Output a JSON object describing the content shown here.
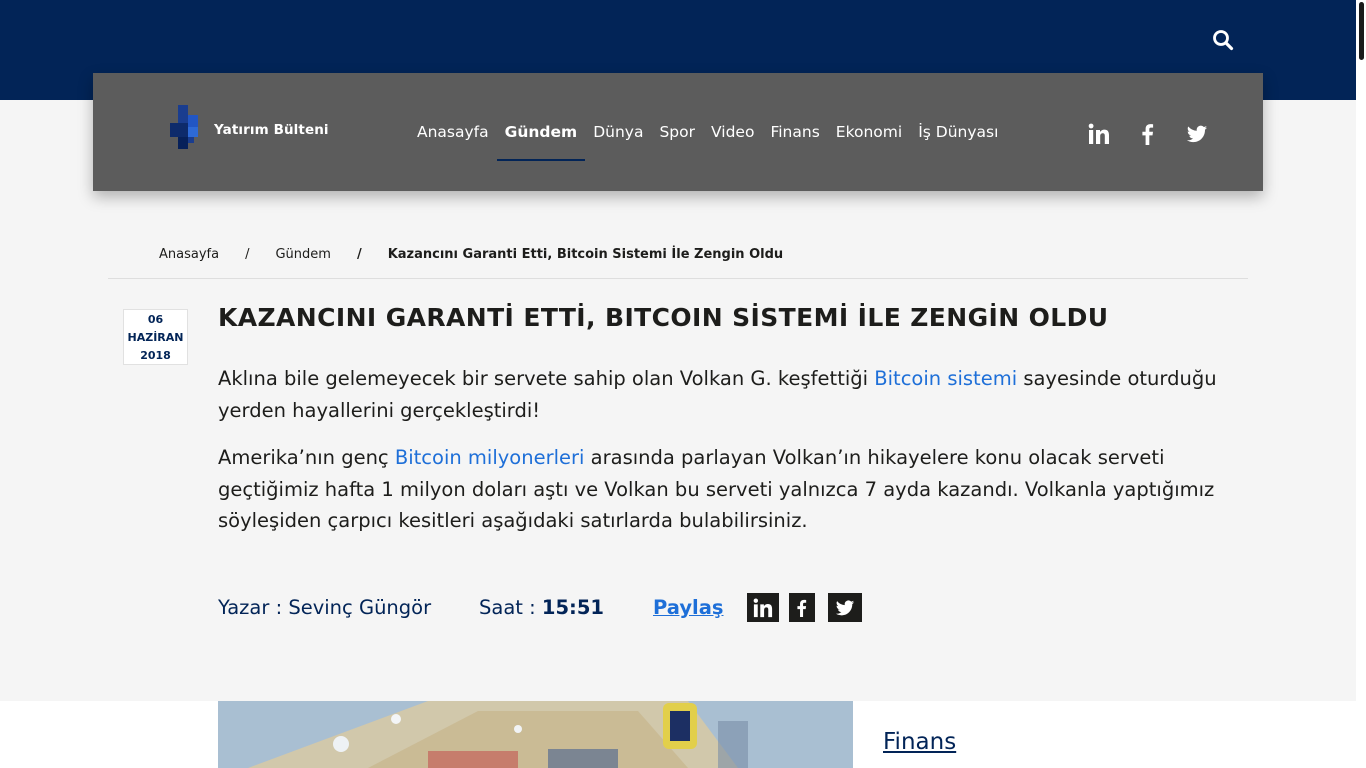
{
  "header": {
    "search_icon": "search-icon",
    "logo_text": "Yatırım Bülteni",
    "menu": [
      {
        "label": "Anasayfa",
        "active": false
      },
      {
        "label": "Gündem",
        "active": true
      },
      {
        "label": "Dünya",
        "active": false
      },
      {
        "label": "Spor",
        "active": false
      },
      {
        "label": "Video",
        "active": false
      },
      {
        "label": "Finans",
        "active": false
      },
      {
        "label": "Ekonomi",
        "active": false
      },
      {
        "label": "İş Dünyası",
        "active": false
      }
    ],
    "social": [
      "linkedin-icon",
      "facebook-icon",
      "twitter-icon"
    ]
  },
  "breadcrumb": {
    "home": "Anasayfa",
    "section": "Gündem",
    "separator": "/",
    "current": "Kazancını Garanti Etti, Bitcoin Sistemi İle Zengin Oldu"
  },
  "article": {
    "date": {
      "day": "06",
      "month": "HAZİRAN",
      "year": "2018"
    },
    "title": "KAZANCINI GARANTİ ETTİ, BITCOIN SİSTEMİ İLE ZENGİN OLDU",
    "p1": {
      "before": "Aklına bile gelemeyecek bir servete sahip olan Volkan G. keşfettiği ",
      "link": "Bitcoin sistemi",
      "after": " sayesinde oturduğu yerden hayallerini gerçekleştirdi!"
    },
    "p2": {
      "before": "Amerika’nın genç ",
      "link": "Bitcoin milyonerleri",
      "after": " arasında parlayan Volkan’ın hikayelere konu olacak serveti geçtiğimiz hafta 1 milyon doları aştı ve Volkan bu serveti yalnızca 7 ayda kazandı. Volkanla yaptığımız söyleşiden çarpıcı kesitleri aşağıdaki satırlarda bulabilirsiniz."
    },
    "author_label": "Yazar : Sevinç Güngör",
    "time_label": "Saat : ",
    "time_value": "15:51",
    "share_label": "Paylaş",
    "category": "Finans"
  },
  "colors": {
    "navy": "#022457",
    "nav_gray": "#5c5c5c",
    "link_blue": "#1e6fd8",
    "page_bg": "#f5f5f5"
  }
}
